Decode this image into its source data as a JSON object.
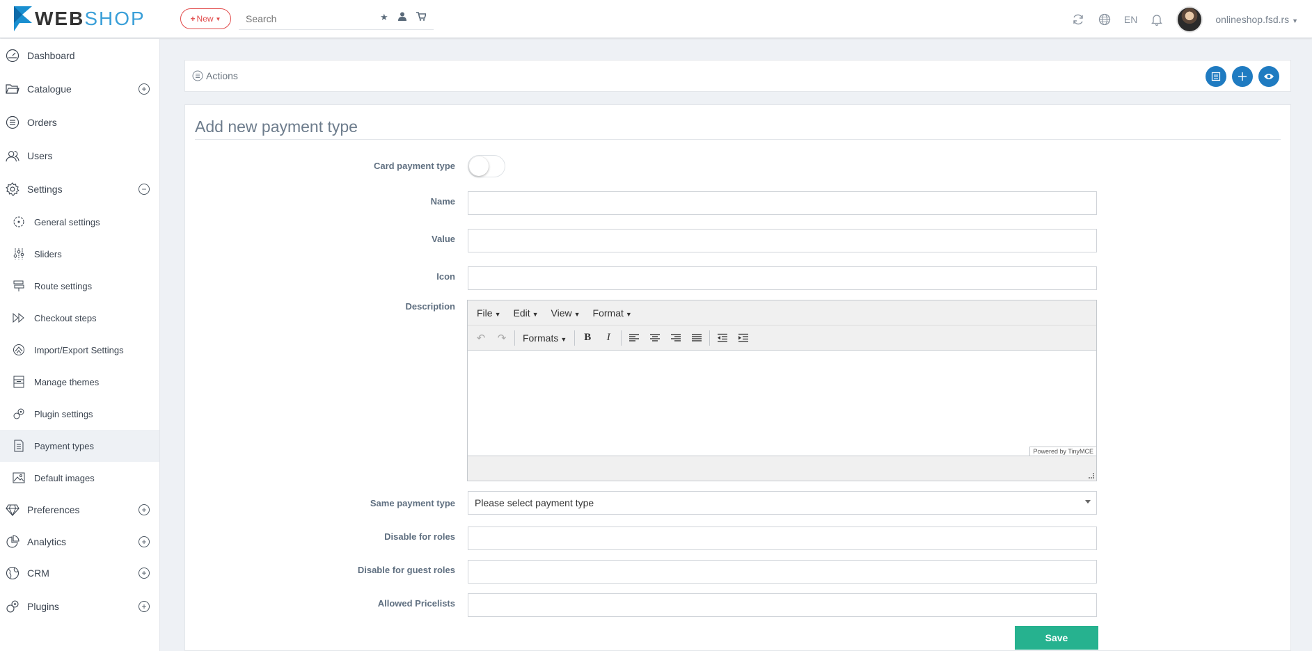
{
  "header": {
    "logo_web": "WEB",
    "logo_shop": "SHOP",
    "new_label": "New",
    "search_placeholder": "Search",
    "language": "EN",
    "user": "onlineshop.fsd.rs"
  },
  "sidebar": {
    "items": [
      {
        "label": "Dashboard",
        "icon": "dashboard-icon"
      },
      {
        "label": "Catalogue",
        "icon": "folder-icon",
        "toggle": "+"
      },
      {
        "label": "Orders",
        "icon": "list-icon"
      },
      {
        "label": "Users",
        "icon": "users-icon"
      },
      {
        "label": "Settings",
        "icon": "gear-icon",
        "toggle": "−"
      },
      {
        "label": "Preferences",
        "icon": "diamond-icon",
        "toggle": "+"
      },
      {
        "label": "Analytics",
        "icon": "pie-chart-icon",
        "toggle": "+"
      },
      {
        "label": "CRM",
        "icon": "globe-icon",
        "toggle": "+"
      },
      {
        "label": "Plugins",
        "icon": "plug-icon",
        "toggle": "+"
      }
    ],
    "settings_sub": [
      {
        "label": "General settings",
        "icon": "settings-circle-icon"
      },
      {
        "label": "Sliders",
        "icon": "sliders-icon"
      },
      {
        "label": "Route settings",
        "icon": "signpost-icon"
      },
      {
        "label": "Checkout steps",
        "icon": "fast-forward-icon"
      },
      {
        "label": "Import/Export Settings",
        "icon": "import-export-icon"
      },
      {
        "label": "Manage themes",
        "icon": "theme-icon"
      },
      {
        "label": "Plugin settings",
        "icon": "plugin-settings-icon"
      },
      {
        "label": "Payment types",
        "icon": "document-icon",
        "active": true
      },
      {
        "label": "Default images",
        "icon": "image-icon"
      }
    ]
  },
  "actions": {
    "label": "Actions"
  },
  "form": {
    "title": "Add new payment type",
    "card_payment_label": "Card payment type",
    "card_payment_on": false,
    "name_label": "Name",
    "name_value": "",
    "value_label": "Value",
    "value_value": "",
    "icon_label": "Icon",
    "icon_value": "",
    "description_label": "Description",
    "same_payment_label": "Same payment type",
    "same_payment_selected": "Please select payment type",
    "disable_roles_label": "Disable for roles",
    "disable_guest_label": "Disable for guest roles",
    "pricelists_label": "Allowed Pricelists",
    "save_label": "Save"
  },
  "editor": {
    "menus": [
      "File",
      "Edit",
      "View",
      "Format"
    ],
    "formats_label": "Formats",
    "powered": "Powered by TinyMCE"
  }
}
